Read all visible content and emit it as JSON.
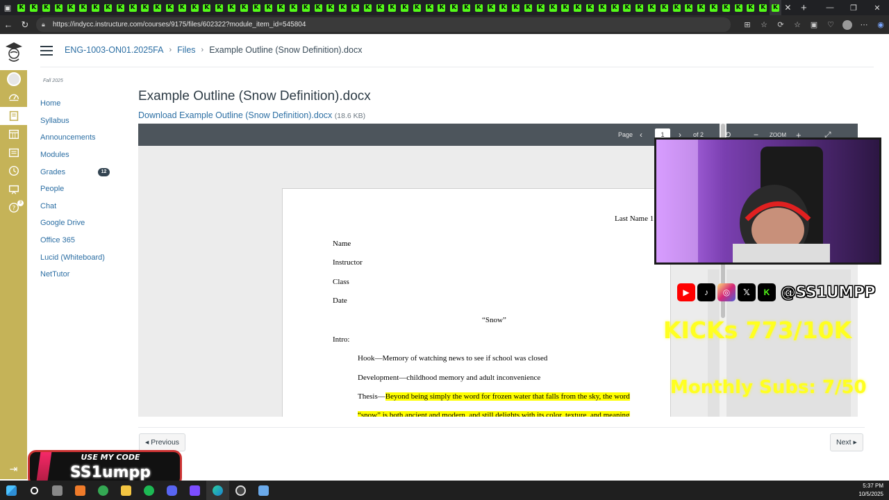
{
  "browser": {
    "kick_tab_count": 62,
    "url": "https://indycc.instructure.com/courses/9175/files/602322?module_item_id=545804"
  },
  "header": {
    "crumbs": [
      "ENG-1003-ON01.2025FA",
      "Files",
      "Example Outline (Snow Definition).docx"
    ]
  },
  "course_nav": {
    "term": "Fall 2025",
    "items": [
      {
        "label": "Home"
      },
      {
        "label": "Syllabus"
      },
      {
        "label": "Announcements"
      },
      {
        "label": "Modules"
      },
      {
        "label": "Grades",
        "badge": "12"
      },
      {
        "label": "People"
      },
      {
        "label": "Chat"
      },
      {
        "label": "Google Drive"
      },
      {
        "label": "Office 365"
      },
      {
        "label": "Lucid (Whiteboard)"
      },
      {
        "label": "NetTutor"
      }
    ]
  },
  "global_nav": {
    "help_badge": "3"
  },
  "content": {
    "title": "Example Outline (Snow Definition).docx",
    "download_label": "Download Example Outline (Snow Definition).docx",
    "download_size": "(18.6 KB)"
  },
  "viewer": {
    "page_label": "Page",
    "page_value": "1",
    "of_label": "of 2",
    "zoom_label": "ZOOM"
  },
  "document": {
    "header_right": "Last Name 1",
    "lines": [
      "Name",
      "Instructor",
      "Class",
      "Date"
    ],
    "doc_title": "“Snow”",
    "intro": "Intro:",
    "hook": "Hook—Memory of watching news to see if school was closed",
    "development": "Development—childhood memory and adult inconvenience",
    "thesis_prefix": "Thesis—",
    "thesis_hl": "Beyond being simply the word for frozen water that falls from the sky, the word",
    "thesis_hl2": "“snow” is both ancient and modern, and still delights with its color, texture, and meaning"
  },
  "footer": {
    "previous": "◂ Previous",
    "next": "Next ▸"
  },
  "overlay": {
    "handle": "@SS1UMPP",
    "kicks": "KICKs 773/10K",
    "subs": "Monthly Subs: 7/50",
    "promo_top": "USE MY CODE",
    "promo_code": "SS1umpp"
  },
  "taskbar": {
    "time": "5:37 PM",
    "date": "10/5/2025"
  },
  "colors": {
    "canvas_nav": "#c5b358",
    "link": "#2b6ea3",
    "kick_green": "#53fc18",
    "overlay_yellow": "#ffff20"
  }
}
